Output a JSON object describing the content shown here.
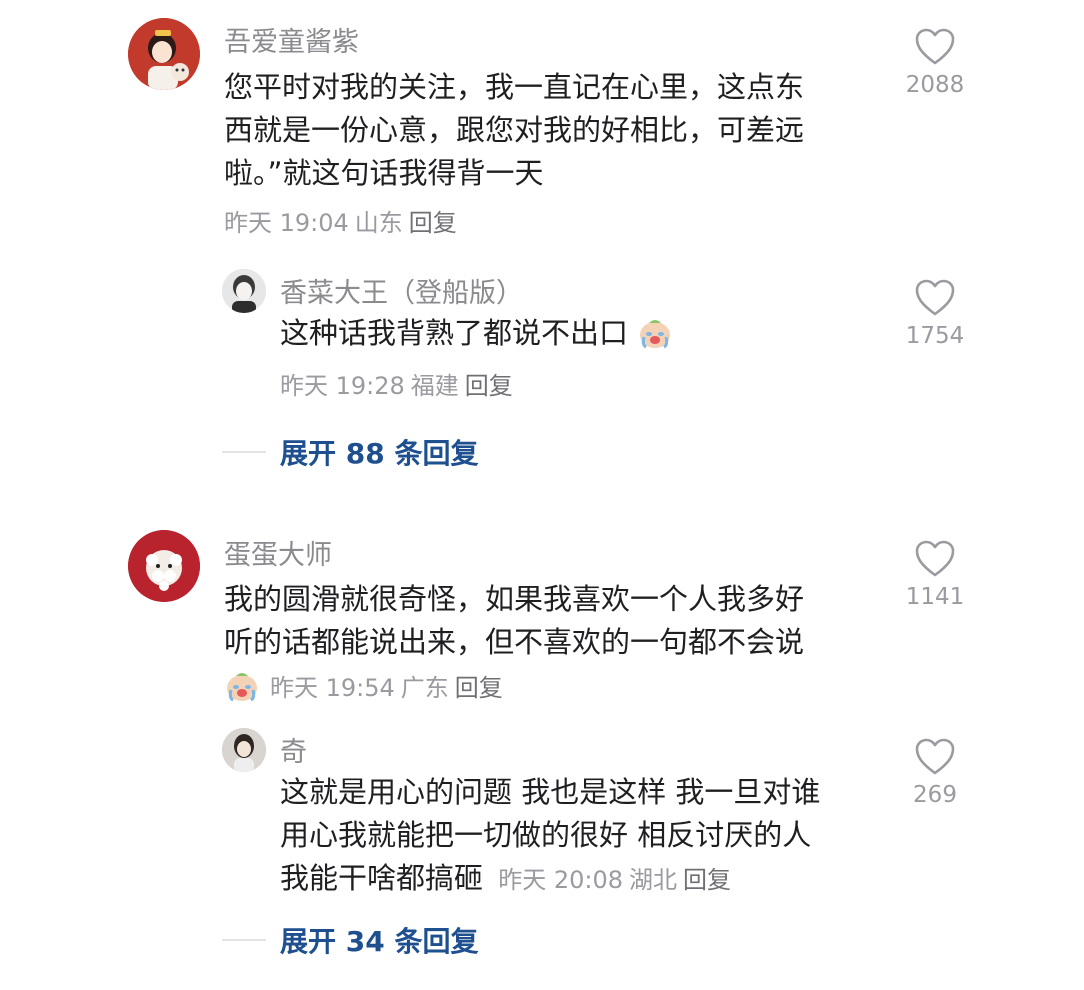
{
  "comments": [
    {
      "user": "吾爱童酱紫",
      "lines": [
        "您平时对我的关注，我一直记在心里，这点东",
        "西就是一份心意，跟您对我的好相比，可差远",
        "啦。”就这句话我得背一天"
      ],
      "time": "昨天 19:04",
      "location": "山东",
      "reply": "回复",
      "likes": "2088",
      "sub": {
        "user": "香菜大王（登船版）",
        "text": "这种话我背熟了都说不出口",
        "emoji": "crying-face-emoji",
        "time": "昨天 19:28",
        "location": "福建",
        "reply": "回复",
        "likes": "1754"
      },
      "expand": "展开 88 条回复"
    },
    {
      "user": "蛋蛋大师",
      "lines": [
        "我的圆滑就很奇怪，如果我喜欢一个人我多好",
        "听的话都能说出来，但不喜欢的一句都不会说"
      ],
      "emoji": "crying-face-emoji",
      "time": "昨天 19:54",
      "location": "广东",
      "reply": "回复",
      "likes": "1141",
      "sub": {
        "user": "奇",
        "lines": [
          "这就是用心的问题 我也是这样 我一旦对谁",
          "用心我就能把一切做的很好 相反讨厌的人",
          "我能干啥都搞砸"
        ],
        "time": "昨天 20:08",
        "location": "湖北",
        "reply": "回复",
        "likes": "269"
      },
      "expand": "展开 34 条回复"
    }
  ],
  "colors": {
    "expand": "#1e4f8f",
    "meta": "#9a9aa0",
    "name": "#8a8a8f"
  }
}
